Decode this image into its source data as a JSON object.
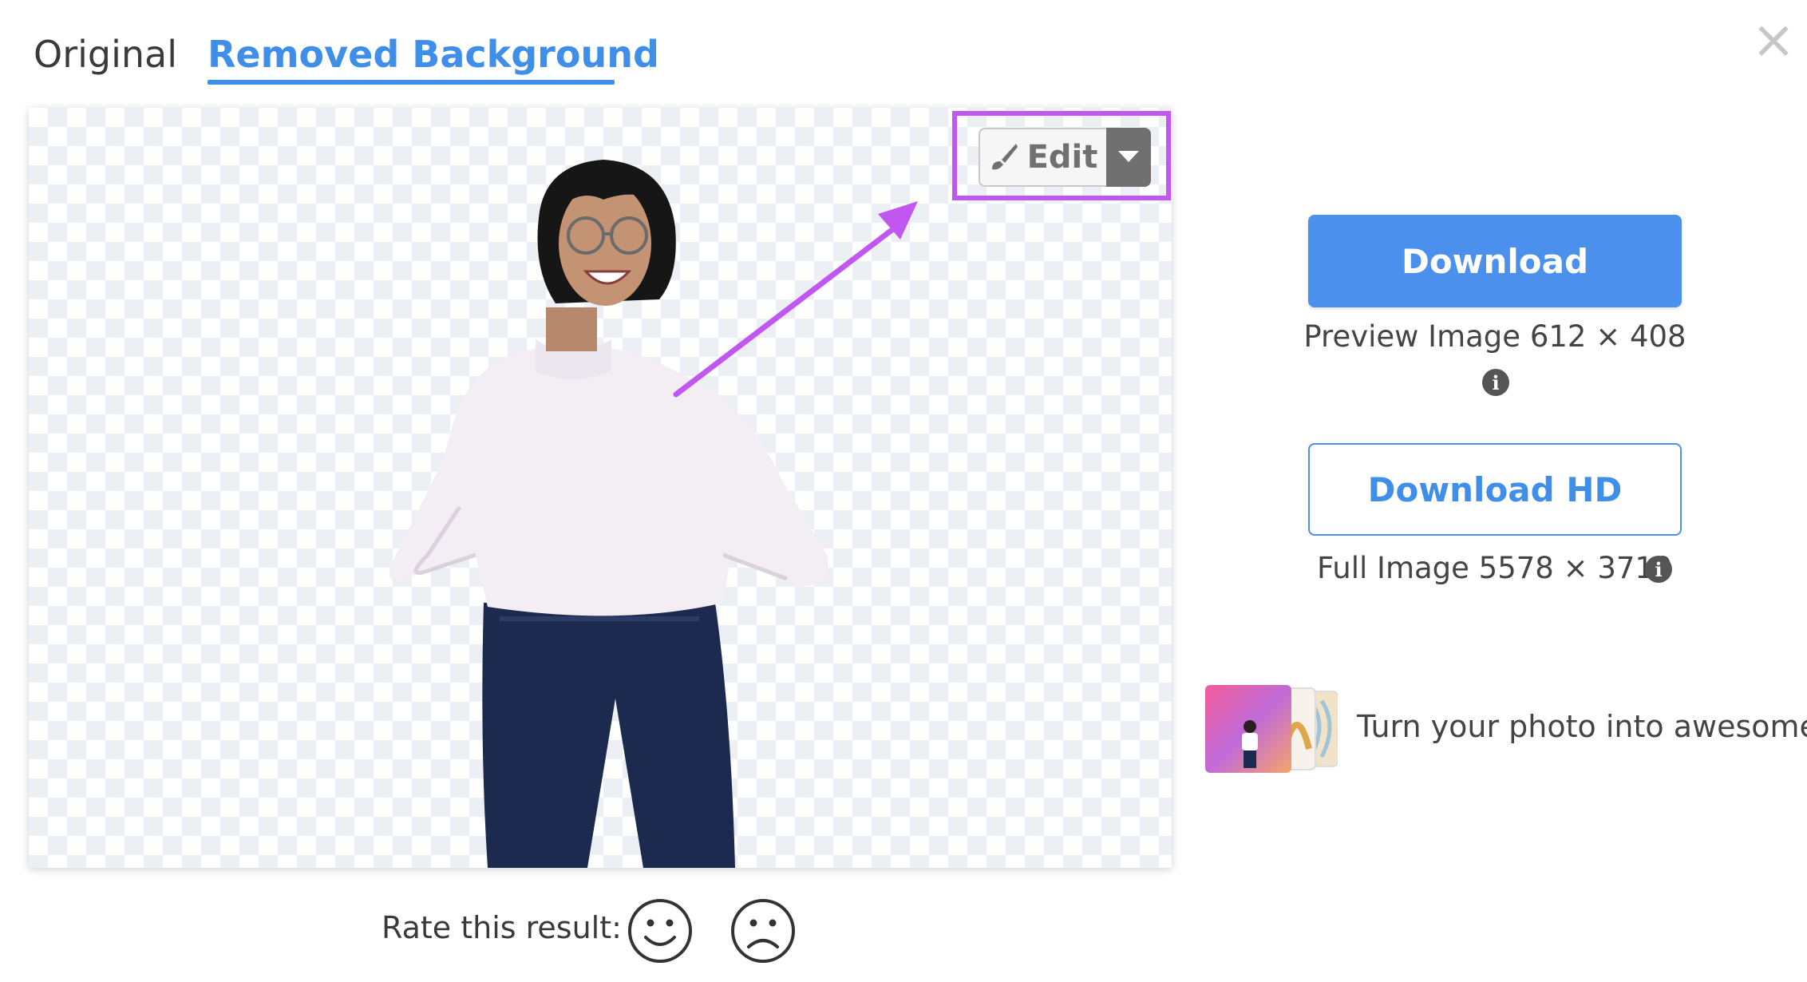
{
  "tabs": {
    "original": "Original",
    "removed_background": "Removed Background"
  },
  "close_icon": "×",
  "edit": {
    "label": "Edit",
    "icon": "paintbrush-icon",
    "dropdown_icon": "caret-down-icon"
  },
  "rating": {
    "label": "Rate this result:"
  },
  "download": {
    "label": "Download",
    "preview_info": "Preview Image 612 × 408"
  },
  "download_hd": {
    "label": "Download HD",
    "full_info": "Full Image 5578 × 3719"
  },
  "info_icon_glyph": "i",
  "promo": {
    "text": "Turn your photo into awesome"
  },
  "colors": {
    "accent": "#4a90ec",
    "highlight": "#c157f0",
    "checker": "#eceff3"
  }
}
